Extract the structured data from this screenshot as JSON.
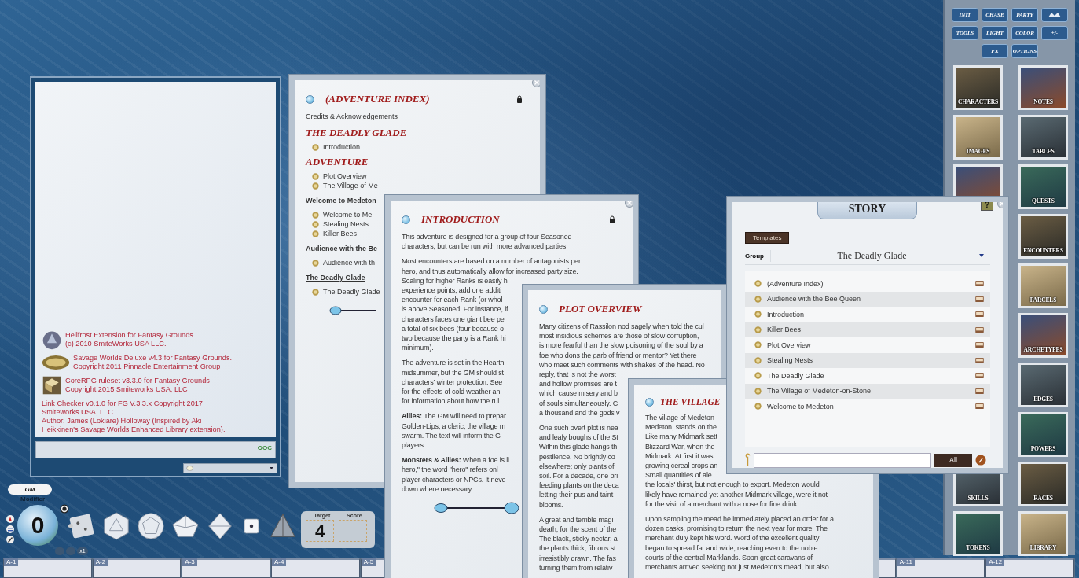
{
  "chat": {
    "credits": [
      {
        "kind": "portrait",
        "lines": [
          "Hellfrost Extension for Fantasy Grounds",
          "(c) 2010 SmiteWorks USA LLC."
        ]
      },
      {
        "kind": "oval",
        "lines": [
          "Savage Worlds Deluxe v4.3 for Fantasy Grounds.",
          "Copyright 2011 Pinnacle Entertainment Group"
        ]
      },
      {
        "kind": "cube",
        "lines": [
          "CoreRPG ruleset v3.3.0 for Fantasy Grounds",
          "Copyright 2015 Smiteworks USA, LLC"
        ]
      }
    ],
    "note": [
      "Link Checker v0.1.0 for FG V.3.3.x Copyright 2017",
      "Smiteworks USA, LLC.",
      "Author: James (Lokiare) Holloway (Inspired by Aki",
      "Heikkinen's Savage Worlds Enhanced Library extension)."
    ],
    "ooc_button": "OOC"
  },
  "identity": {
    "label": "GM"
  },
  "modifier": {
    "label": "Modifier",
    "value": "0",
    "multiplier": "x1"
  },
  "target_box": {
    "target_label": "Target",
    "score_label": "Score",
    "target": "4"
  },
  "hotkeys": {
    "left": [
      "A-1",
      "A-2",
      "A-3",
      "A-4",
      "A-5"
    ],
    "right": [
      "A-11",
      "A-12"
    ]
  },
  "index_window": {
    "title": "(ADVENTURE INDEX)",
    "entries": [
      {
        "kind": "plain",
        "text": "Credits & Acknowledgements"
      },
      {
        "kind": "heading",
        "text": "THE DEADLY GLADE"
      },
      {
        "kind": "link",
        "text": "Introduction"
      },
      {
        "kind": "heading",
        "text": "ADVENTURE"
      },
      {
        "kind": "link",
        "text": "Plot Overview"
      },
      {
        "kind": "link",
        "text": "The Village of Me"
      },
      {
        "kind": "subheading",
        "text": "Welcome to Medeton"
      },
      {
        "kind": "link",
        "text": "Welcome to Me"
      },
      {
        "kind": "link",
        "text": "Stealing Nests"
      },
      {
        "kind": "link",
        "text": "Killer Bees"
      },
      {
        "kind": "subheading",
        "text": "Audience with the Be"
      },
      {
        "kind": "link",
        "text": "Audience with th"
      },
      {
        "kind": "subheading",
        "text": "The Deadly Glade"
      },
      {
        "kind": "link",
        "text": "The Deadly Glade"
      }
    ]
  },
  "intro_window": {
    "title": "INTRODUCTION",
    "paragraphs": [
      [
        "This adventure is designed for a group of four Seasoned",
        "characters, but can be run with more advanced parties."
      ],
      [
        "Most encounters are based on a number of antagonists per",
        "hero, and thus automatically allow for increased party size."
      ],
      [
        "Scaling for higher Ranks is easily h",
        "experience points, add one additi",
        "encounter for each Rank (or whol",
        "is above Seasoned. For instance, if",
        "characters faces one giant bee pe",
        "a total of six bees (four because o",
        "two because the party is a Rank hi",
        "minimum)."
      ],
      [
        "The adventure is set in the Hearth",
        "midsummer, but the GM should st",
        "characters' winter protection. See",
        "for the effects of cold weather an",
        "for information about how the rul"
      ],
      [
        "**Allies:** The GM will need to prepar",
        "Golden-Lips, a cleric, the village m",
        "swarm. The text will inform the G",
        "players."
      ],
      [
        "**Monsters & Allies:** When a foe is li",
        "hero,\" the word \"hero\" refers onl",
        "player characters or NPCs. It neve",
        "down where necessary"
      ]
    ]
  },
  "plot_window": {
    "title": "PLOT OVERVIEW",
    "paragraphs": [
      [
        "Many citizens of Rassilon nod sagely when told the cul",
        "most insidious schemes are those of slow corruption,",
        "is more fearful than the slow poisoning of the soul by a",
        "foe who dons the garb of friend or mentor? Yet there",
        "who meet such comments with shakes of the head. No"
      ],
      [
        "reply, that is not the worst",
        "and hollow promises are t",
        "which cause misery and b",
        "of souls simultaneously. C",
        "a thousand and the gods v"
      ],
      [
        "One such overt plot is nea",
        "and leafy boughs of the St",
        "Within this glade hangs th",
        "pestilence. No brightly co",
        "elsewhere; only plants of",
        "soil. For a decade, one pri",
        "feeding plants on the deca",
        "letting their pus and taint",
        "blooms."
      ],
      [
        "A great and terrible magi",
        "death, for the scent of the",
        "The black, sticky nectar, a",
        "the plants thick, fibrous st",
        "irresistibly drawn. The fas",
        "turning them from relativ"
      ]
    ]
  },
  "village_window": {
    "title": "THE VILLAGE",
    "paragraphs": [
      [
        "The village of Medeton-",
        "Medeton, stands on the",
        "Like many Midmark sett",
        "Blizzard War, when the",
        "Midmark. At first it was",
        "growing cereal crops an",
        "Small quantities of ale"
      ],
      [
        "the locals' thirst, but not enough to export. Medeton would",
        "likely have remained yet another Midmark village, were it not",
        "for the visit of a merchant with a nose for fine drink."
      ],
      [
        "Upon sampling the mead he immediately placed an order for a",
        "dozen casks, promising to return the next year for more. The",
        "merchant duly kept his word. Word of the excellent quality",
        "began to spread far and wide, reaching even to the noble",
        "courts of the central Marklands. Soon great caravans of",
        "merchants arrived seeking not just Medeton's mead, but also"
      ]
    ]
  },
  "story_window": {
    "title": "STORY",
    "help_button": "?",
    "templates_button": "Templates",
    "group_label": "Group",
    "group_value": "The Deadly Glade",
    "items": [
      "(Adventure Index)",
      "Audience with the Bee Queen",
      "Introduction",
      "Killer Bees",
      "Plot Overview",
      "Stealing Nests",
      "The Deadly Glade",
      "The Village of Medeton-on-Stone",
      "Welcome to Medeton"
    ],
    "filter_button": "All"
  },
  "sidebar": {
    "toolbar": [
      {
        "kind": "text",
        "label": "INIT"
      },
      {
        "kind": "text",
        "label": "CHASE"
      },
      {
        "kind": "text",
        "label": "PARTY"
      },
      {
        "kind": "icon"
      },
      {
        "kind": "text",
        "label": "TOOLS"
      },
      {
        "kind": "text",
        "label": "LIGHT"
      },
      {
        "kind": "text",
        "label": "COLOR"
      },
      {
        "kind": "text",
        "label": "+/-"
      },
      {
        "kind": "text",
        "label": "FX"
      },
      {
        "kind": "text",
        "label": "OPTIONS"
      }
    ],
    "left_top": [
      "CHARACTERS",
      "IMAGES"
    ],
    "left_bottom": [
      "SKILLS",
      "TOKENS"
    ],
    "right": [
      "NOTES",
      "TABLES",
      "QUESTS",
      "ENCOUNTERS",
      "PARCELS",
      "ARCHETYPES",
      "EDGES",
      "POWERS",
      "RACES",
      "LIBRARY"
    ]
  }
}
